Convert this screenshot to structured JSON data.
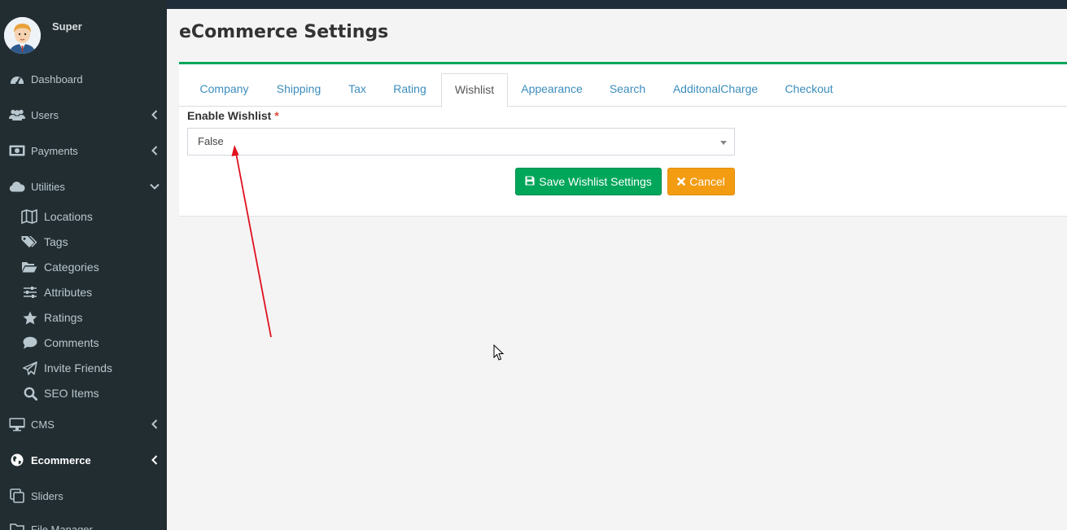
{
  "user": {
    "name": "Super"
  },
  "sidebar": {
    "items": [
      {
        "label": "Dashboard",
        "icon": "dashboard-icon"
      },
      {
        "label": "Users",
        "icon": "users-icon"
      },
      {
        "label": "Payments",
        "icon": "money-icon"
      },
      {
        "label": "Utilities",
        "icon": "cloud-icon"
      },
      {
        "label": "CMS",
        "icon": "desktop-icon"
      },
      {
        "label": "Ecommerce",
        "icon": "globe-icon"
      },
      {
        "label": "Sliders",
        "icon": "clone-icon"
      },
      {
        "label": "File Manager",
        "icon": "folder-icon"
      }
    ],
    "utilities_sub": [
      {
        "label": "Locations",
        "icon": "map-icon"
      },
      {
        "label": "Tags",
        "icon": "tags-icon"
      },
      {
        "label": "Categories",
        "icon": "folder-open-icon"
      },
      {
        "label": "Attributes",
        "icon": "sliders-icon"
      },
      {
        "label": "Ratings",
        "icon": "star-icon"
      },
      {
        "label": "Comments",
        "icon": "comment-icon"
      },
      {
        "label": "Invite Friends",
        "icon": "paper-plane-icon"
      },
      {
        "label": "SEO Items",
        "icon": "search-icon"
      }
    ]
  },
  "page": {
    "title": "eCommerce Settings"
  },
  "tabs": [
    {
      "label": "Company"
    },
    {
      "label": "Shipping"
    },
    {
      "label": "Tax"
    },
    {
      "label": "Rating"
    },
    {
      "label": "Wishlist"
    },
    {
      "label": "Appearance"
    },
    {
      "label": "Search"
    },
    {
      "label": "AdditonalCharge"
    },
    {
      "label": "Checkout"
    }
  ],
  "active_tab": "Wishlist",
  "form": {
    "enable_wishlist_label": "Enable Wishlist",
    "required_mark": "*",
    "enable_wishlist_value": "False",
    "save_label": "Save Wishlist Settings",
    "cancel_label": "Cancel"
  },
  "colors": {
    "sidebar_bg": "#222d32",
    "accent_green": "#00a65a",
    "accent_orange": "#f39c12",
    "link_blue": "#3c8dbc",
    "annotation_red": "#e0101e"
  }
}
